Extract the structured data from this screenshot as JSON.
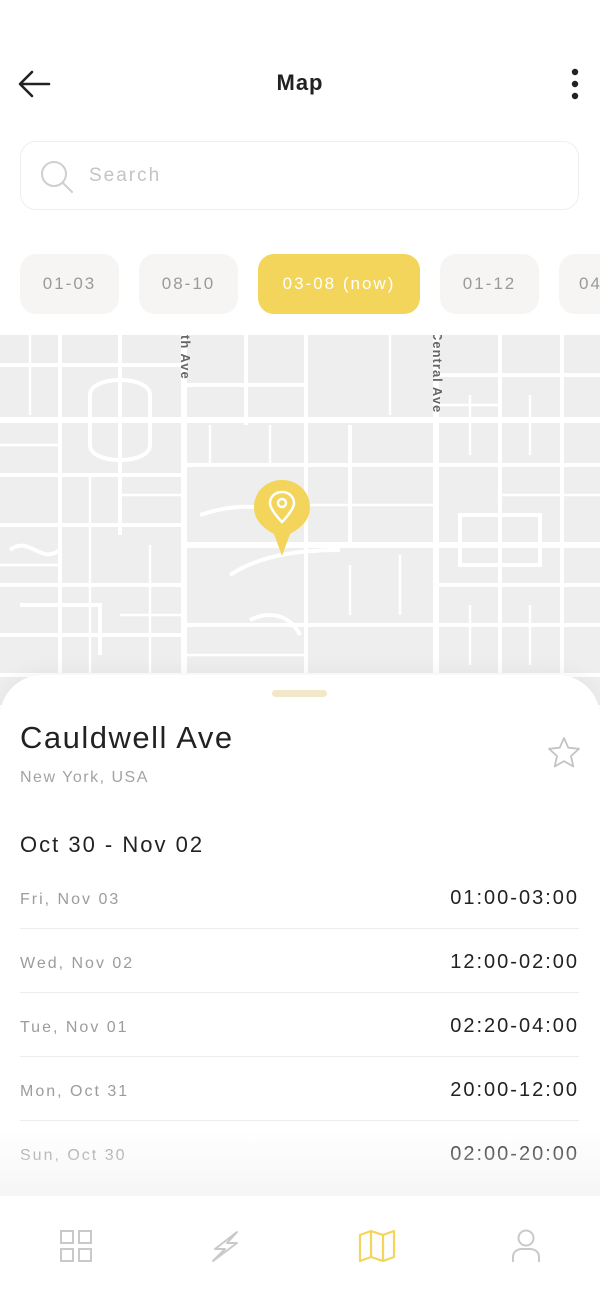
{
  "header": {
    "title": "Map"
  },
  "search": {
    "placeholder": "Search"
  },
  "chips": [
    {
      "label": "01-03",
      "active": false
    },
    {
      "label": "08-10",
      "active": false
    },
    {
      "label": "03-08 (now)",
      "active": true
    },
    {
      "label": "01-12",
      "active": false
    },
    {
      "label": "04",
      "active": false
    }
  ],
  "map": {
    "streets": [
      "th Ave",
      "Central Ave"
    ],
    "pin_color": "#f3d55b"
  },
  "place": {
    "name": "Cauldwell Ave",
    "location": "New York, USA",
    "range": "Oct 30 - Nov 02"
  },
  "schedule": [
    {
      "day": "Fri, Nov 03",
      "time": "01:00-03:00"
    },
    {
      "day": "Wed, Nov 02",
      "time": "12:00-02:00"
    },
    {
      "day": "Tue, Nov 01",
      "time": "02:20-04:00"
    },
    {
      "day": "Mon, Oct 31",
      "time": "20:00-12:00"
    },
    {
      "day": "Sun, Oct 30",
      "time": "02:00-20:00"
    }
  ],
  "tabbar": {
    "items": [
      {
        "icon": "grid-icon",
        "active": false
      },
      {
        "icon": "lightning-icon",
        "active": false
      },
      {
        "icon": "map-icon",
        "active": true
      },
      {
        "icon": "user-icon",
        "active": false
      }
    ]
  },
  "colors": {
    "accent": "#f3d55b",
    "text": "#222222",
    "muted": "#9c9c9c"
  }
}
